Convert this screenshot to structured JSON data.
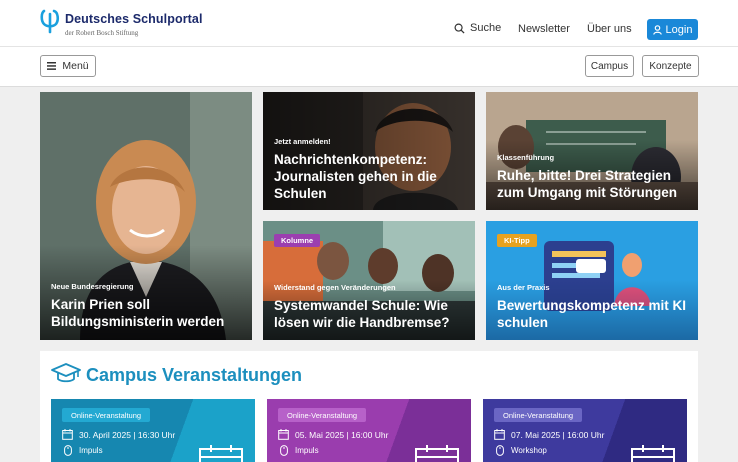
{
  "header": {
    "logo_title": "Deutsches Schulportal",
    "logo_subtitle": "der Robert Bosch Stiftung",
    "search_label": "Suche",
    "newsletter_label": "Newsletter",
    "about_label": "Über uns",
    "login_label": "Login"
  },
  "subnav": {
    "menu_label": "Menü",
    "campus_label": "Campus",
    "konzepte_label": "Konzepte"
  },
  "tiles": {
    "t1": {
      "kicker": "Neue Bundesregierung",
      "headline": "Karin Prien soll Bildungsministerin werden"
    },
    "t2": {
      "kicker": "Jetzt anmelden!",
      "headline": "Nachrichtenkompetenz: Journalisten gehen in die Schulen"
    },
    "t3": {
      "kicker": "Klassenführung",
      "headline": "Ruhe, bitte! Drei Strategien zum Umgang mit Störungen"
    },
    "t4": {
      "badge": "Kolumne",
      "kicker": "Widerstand gegen Veränderungen",
      "headline": "Systemwandel Schule: Wie lösen wir die Handbremse?"
    },
    "t5": {
      "badge": "KI-Tipp",
      "kicker": "Aus der Praxis",
      "headline": "Bewertungskompetenz mit KI schulen"
    }
  },
  "campus": {
    "title": "Campus Veranstaltungen",
    "events": [
      {
        "tag": "Online-Veranstaltung",
        "date": "30. April 2025 | 16:30 Uhr",
        "type": "Impuls"
      },
      {
        "tag": "Online-Veranstaltung",
        "date": "05. Mai 2025 | 16:00 Uhr",
        "type": "Impuls"
      },
      {
        "tag": "Online-Veranstaltung",
        "date": "07. Mai 2025 | 16:00 Uhr",
        "type": "Workshop"
      }
    ]
  },
  "colors": {
    "brand_blue": "#1c2a6b",
    "login_blue": "#1a88d8",
    "campus_teal": "#1c8fbe",
    "event1": "#1595b8",
    "event2": "#9b3fb0",
    "event3": "#3f3a9e"
  },
  "icons": [
    "logo-icon",
    "search-icon",
    "user-icon",
    "hamburger-icon",
    "graduation-cap-icon",
    "calendar-icon",
    "mouse-icon"
  ]
}
